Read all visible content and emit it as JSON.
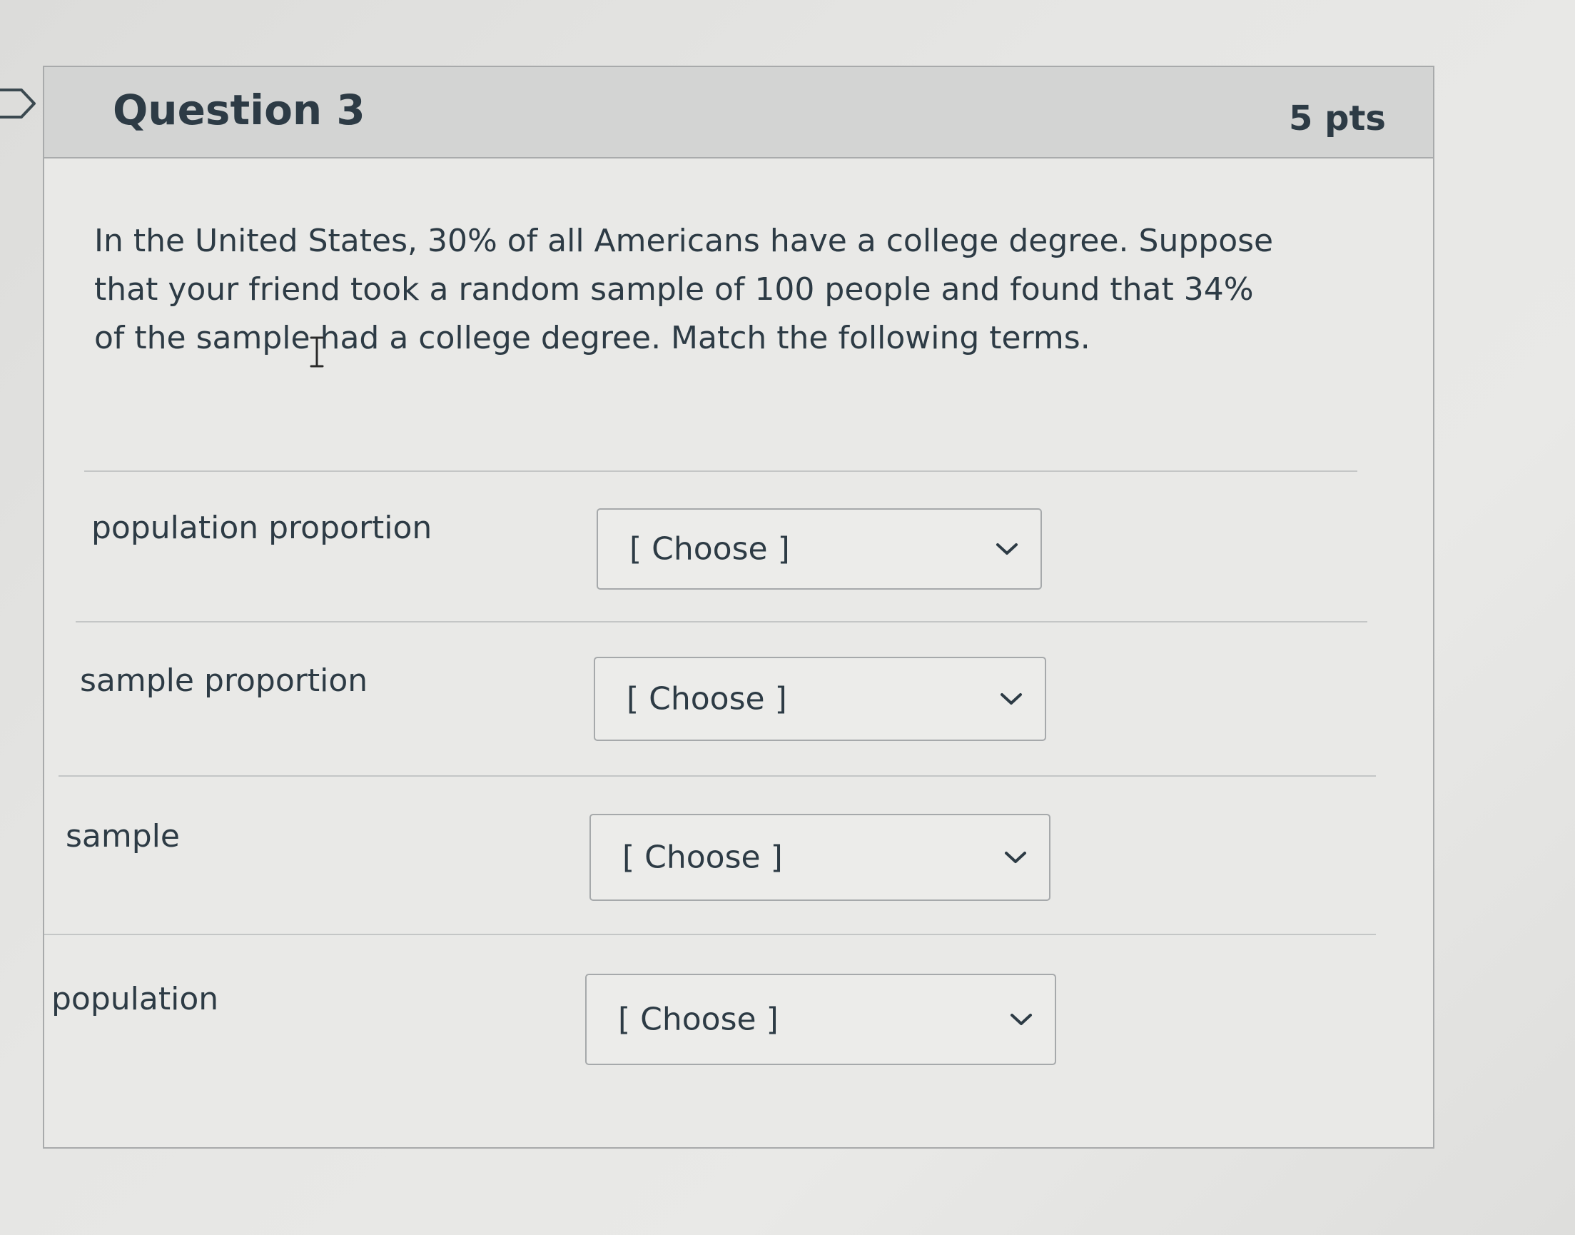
{
  "question": {
    "title": "Question 3",
    "points": "5 pts",
    "text": "In the United States, 30% of all Americans have a college degree. Suppose that your friend took a random sample of 100 people and found that 34% of the sample had a college degree.  Match the following terms."
  },
  "matches": [
    {
      "term": "population proportion",
      "selected": "[ Choose ]"
    },
    {
      "term": "sample proportion",
      "selected": "[ Choose ]"
    },
    {
      "term": "sample",
      "selected": "[ Choose ]"
    },
    {
      "term": "population",
      "selected": "[ Choose ]"
    }
  ],
  "icons": {
    "dropdown": "chevron-down-icon",
    "flag": "question-flag-icon",
    "cursor": "text-cursor-icon"
  }
}
